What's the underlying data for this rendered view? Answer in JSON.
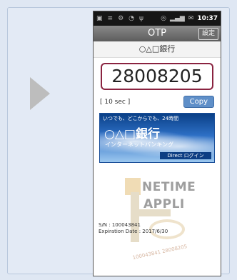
{
  "phone": {
    "status_icons_left": [
      "window-icon",
      "bars-icon",
      "gear-icon",
      "wifi-icon",
      "usb-icon"
    ],
    "status_icons_right": [
      "sync-icon",
      "signal-icon",
      "mail-icon"
    ],
    "time": "10:37"
  },
  "appbar": {
    "title": "OTP",
    "settings_label": "設定"
  },
  "bank_name": "○△□銀行",
  "otp_code": "28008205",
  "timer": "[ 10 sec ]",
  "copy_label": "Copy",
  "banner": {
    "tagline": "いつでも、どこからでも、24時間",
    "bank": "○△□銀行",
    "service": "インターネットバンキング",
    "login": "Direct ログイン"
  },
  "logo": {
    "line1": "NETIME",
    "line2": "APPLI"
  },
  "serial": "S/N : 100043841",
  "expiration": "Expiration Date : 2017/6/30",
  "watermark_text": "100043841 28008205"
}
